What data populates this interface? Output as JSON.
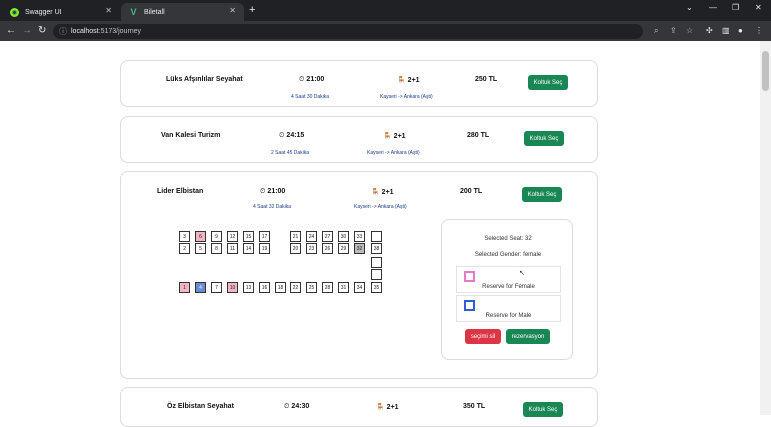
{
  "browser": {
    "tabs": [
      {
        "title": "Swagger UI",
        "favicon": "swagger-icon",
        "active": false
      },
      {
        "title": "Biletall",
        "favicon": "vue-icon",
        "active": true
      }
    ],
    "url_host": "localhost",
    "url_path": ":5173/journey"
  },
  "journeys": [
    {
      "company": "Lüks Afşınlılar Seyahat",
      "time": "21:00",
      "duration": "4 Saat 30 Dakika",
      "seat_type": "2+1",
      "route": "Kayseri -> Ankara (Aşti)",
      "price": "250 TL",
      "button": "Koltuk Seç"
    },
    {
      "company": "Van Kalesi Turizm",
      "time": "24:15",
      "duration": "2 Saat 45 Dakika",
      "seat_type": "2+1",
      "route": "Kayseri -> Ankara (Aşti)",
      "price": "280 TL",
      "button": "Koltuk Seç"
    },
    {
      "company": "Lider Elbistan",
      "time": "21:00",
      "duration": "4 Saat 32 Dakika",
      "seat_type": "2+1",
      "route": "Kayseri -> Ankara (Aşti)",
      "price": "200 TL",
      "button": "Koltuk Seç"
    },
    {
      "company": "Öz Elbistan Seyahat",
      "time": "24:30",
      "duration": "",
      "seat_type": "2+1",
      "route": "",
      "price": "350 TL",
      "button": "Koltuk Seç"
    }
  ],
  "seat_map": {
    "top_row": [
      "3",
      "6",
      "9",
      "12",
      "15",
      "17",
      "21",
      "24",
      "27",
      "30",
      "33",
      ""
    ],
    "middle_row": [
      "2",
      "5",
      "8",
      "11",
      "14",
      "19",
      "20",
      "23",
      "26",
      "29",
      "32",
      "38"
    ],
    "bottom_row": [
      "1",
      "4",
      "7",
      "10",
      "13",
      "16",
      "18",
      "22",
      "25",
      "28",
      "31",
      "34",
      "35"
    ],
    "female_seats": [
      "6",
      "1",
      "10"
    ],
    "male_seats": [
      "4"
    ],
    "selected_seat": "32"
  },
  "panel": {
    "selected_seat_text": "Selected Seat: 32",
    "selected_gender_text": "Selected Gender: female",
    "female_label": "Reserve for Female",
    "male_label": "Reserve for Male",
    "clear_button": "seçimi sil",
    "reserve_button": "rezervasyon",
    "colors": {
      "female": "#e879c9",
      "male": "#2d5fd6",
      "clear": "#dc3545",
      "reserve": "#198754"
    }
  }
}
